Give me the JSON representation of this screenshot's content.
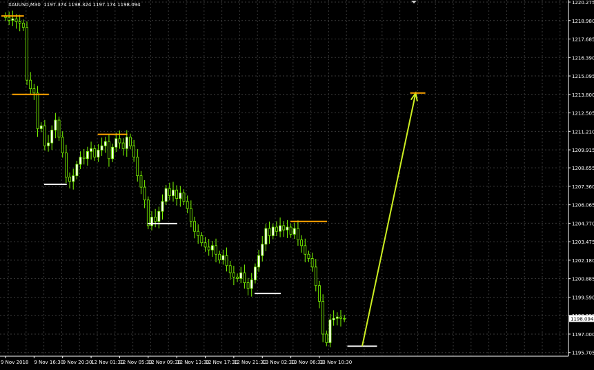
{
  "header": {
    "symbol": "XAUUSD,M30",
    "ohlc": "1197.374 1198.324 1197.174 1198.094"
  },
  "colors": {
    "background": "#000000",
    "grid": "#3a3a3a",
    "bull_candle": "#ffffff",
    "bear_candle": "#000000",
    "candle_outline": "#7cfc00",
    "support_line": "#ffffff",
    "resistance_line": "#ffa500",
    "arrow": "#ccee22",
    "price_label_bg": "#ffffff",
    "price_label_text": "#000000"
  },
  "chart_data": {
    "type": "candlestick",
    "y_axis_ticks": [
      "1220.275",
      "1218.980",
      "1217.685",
      "1216.390",
      "1215.095",
      "1213.800",
      "1212.505",
      "1211.210",
      "1209.915",
      "1208.655",
      "1207.360",
      "1206.065",
      "1204.770",
      "1203.475",
      "1202.180",
      "1200.885",
      "1199.590",
      "1198.295",
      "1197.000",
      "1195.705"
    ],
    "y_axis_tick_values": [
      1220.275,
      1218.98,
      1217.685,
      1216.39,
      1215.095,
      1213.8,
      1212.505,
      1211.21,
      1209.915,
      1208.655,
      1207.36,
      1206.065,
      1204.77,
      1203.475,
      1202.18,
      1200.885,
      1199.59,
      1198.295,
      1197.0,
      1195.705
    ],
    "y_range": [
      1195.45,
      1220.42
    ],
    "x_axis_labels": [
      "9 Nov 2018",
      "9 Nov 16:30",
      "9 Nov 20:30",
      "12 Nov 01:30",
      "12 Nov 05:30",
      "12 Nov 09:30",
      "12 Nov 13:30",
      "12 Nov 17:30",
      "12 Nov 21:30",
      "13 Nov 02:30",
      "13 Nov 06:30",
      "13 Nov 10:30"
    ],
    "x_axis_label_bar_index": [
      0,
      8,
      16,
      24,
      32,
      40,
      48,
      56,
      64,
      72,
      80,
      88
    ],
    "current_price": "1198.094",
    "current_price_value": 1198.094,
    "bar_count": 96,
    "closes": [
      1219.2,
      1219.0,
      1219.1,
      1218.9,
      1218.8,
      1218.5,
      1214.8,
      1214.2,
      1213.9,
      1211.4,
      1211.6,
      1210.2,
      1210.4,
      1211.3,
      1212.0,
      1210.8,
      1209.7,
      1208.0,
      1207.7,
      1208.1,
      1208.9,
      1209.4,
      1209.3,
      1209.8,
      1210.0,
      1209.4,
      1209.9,
      1210.2,
      1210.5,
      1209.3,
      1210.1,
      1210.7,
      1210.4,
      1210.0,
      1210.8,
      1210.2,
      1209.4,
      1208.1,
      1207.3,
      1206.4,
      1204.6,
      1205.2,
      1204.9,
      1205.6,
      1206.3,
      1207.2,
      1206.7,
      1207.1,
      1206.5,
      1206.9,
      1206.3,
      1205.8,
      1204.9,
      1204.2,
      1203.9,
      1203.4,
      1203.1,
      1202.9,
      1203.2,
      1202.6,
      1202.2,
      1202.5,
      1201.8,
      1201.3,
      1201.0,
      1200.9,
      1201.3,
      1200.6,
      1200.2,
      1200.8,
      1201.7,
      1202.5,
      1203.3,
      1204.4,
      1203.9,
      1204.5,
      1204.2,
      1204.6,
      1204.3,
      1204.5,
      1204.0,
      1204.4,
      1203.6,
      1203.2,
      1202.6,
      1202.3,
      1201.7,
      1200.4,
      1199.3,
      1197.0,
      1196.4,
      1198.0,
      1198.1,
      1198.2,
      1198.1,
      1198.09
    ],
    "levels": [
      {
        "kind": "resistance",
        "bars": [
          0,
          4
        ],
        "value": 1219.3
      },
      {
        "kind": "resistance",
        "bars": [
          3,
          11
        ],
        "value": 1213.8
      },
      {
        "kind": "support",
        "bars": [
          12,
          16
        ],
        "value": 1207.5
      },
      {
        "kind": "resistance",
        "bars": [
          27,
          33
        ],
        "value": 1211.0
      },
      {
        "kind": "support",
        "bars": [
          41,
          47
        ],
        "value": 1204.75
      },
      {
        "kind": "support",
        "bars": [
          71,
          76
        ],
        "value": 1199.85
      },
      {
        "kind": "resistance",
        "bars": [
          81,
          89
        ],
        "value": 1204.9
      },
      {
        "kind": "support",
        "bars": [
          97,
          103
        ],
        "value": 1196.15
      }
    ],
    "arrow": {
      "from_bar": 100,
      "from_value": 1196.15,
      "to_bar": 115,
      "to_value": 1213.9
    },
    "grid": true
  }
}
